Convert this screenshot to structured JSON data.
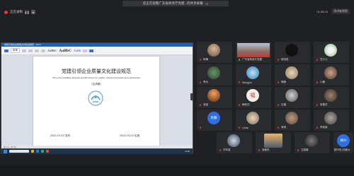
{
  "banner": {
    "title": "您正在观看广东省商务厅党建...的共享屏幕",
    "count": "75"
  },
  "toolbar": {
    "record_label": "正在录制"
  },
  "top_right": {
    "timer": "01:58:16",
    "view_label": "演讲者视图"
  },
  "shared": {
    "window_title": "党建引领企业质量文化建设规范 - Word",
    "ribbon_style1": "AaBbC",
    "ribbon_style2": "AaBbC",
    "ribbon_style3": "AaBb",
    "font_box": "宋体",
    "doc_title": "党建引领企业质量文化建设规范",
    "doc_subtitle": "The party building leads the specifications for quality culture development in enterprises",
    "doc_draft": "（征求稿）",
    "date_left": "2023-XX-XX 发布",
    "date_right": "2023-XX-XX 实施",
    "statusbar": "第 1 页，共 6 页",
    "taskbar_time": "11:52"
  },
  "participants": [
    {
      "name": "阿梅"
    },
    {
      "name": "广东省商务厅党建"
    },
    {
      "name": "哈哈哈"
    },
    {
      "name": "豆汁儿"
    },
    {
      "name": "青木"
    },
    {
      "name": "Wangjun"
    },
    {
      "name": "晴朗"
    },
    {
      "name": "小鹿"
    },
    {
      "name": "漫漫"
    },
    {
      "name": "梅林花"
    },
    {
      "name": "石榴"
    },
    {
      "name": "张春花"
    },
    {
      "name": "宋鹏",
      "initials": "宋鹏"
    },
    {
      "name": "Linda"
    },
    {
      "name": "海滨"
    },
    {
      "name": "李某某"
    },
    {
      "name": "刘华英"
    },
    {
      "name": "成都杰"
    },
    {
      "name": "卫国春"
    },
    {
      "name": "顾兴旺-石峰ok",
      "initials": "顾兴"
    }
  ],
  "colors": {
    "record": "#e53935",
    "accent": "#2c5cc5"
  }
}
